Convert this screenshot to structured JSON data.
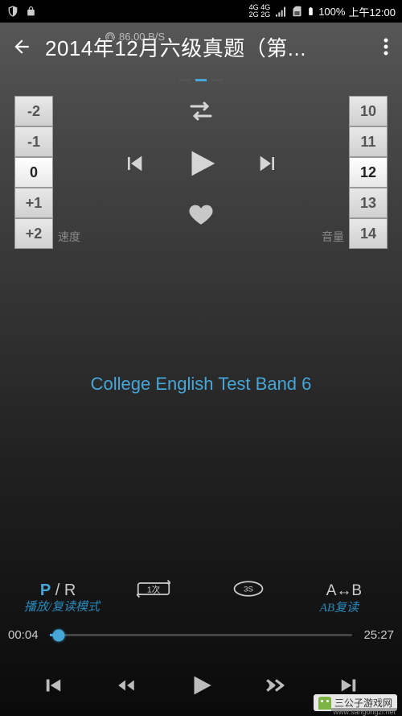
{
  "status_bar": {
    "net_4g": "4G",
    "net_2g": "2G",
    "sub_4g": "4G",
    "sub_2g": "2G",
    "battery": "100%",
    "time": "上午12:00"
  },
  "net_speed": "86.00 B/S",
  "header": {
    "title": "2014年12月六级真题（第..."
  },
  "speed_dial": {
    "items": [
      "-2",
      "-1",
      "0",
      "+1",
      "+2"
    ],
    "selected_index": 2,
    "label": "速度"
  },
  "volume_dial": {
    "items": [
      "10",
      "11",
      "12",
      "13",
      "14"
    ],
    "selected_index": 2,
    "label": "音量"
  },
  "transcript": "College English Test Band 6",
  "mode_row": {
    "pr_p": "P",
    "pr_slash": " / ",
    "pr_r": "R",
    "pr_annotation": "播放/复读模式",
    "repeat_count": "1次",
    "interval": "3S",
    "ab": "A↔B",
    "ab_annotation": "AB复读"
  },
  "progress": {
    "current": "00:04",
    "total": "25:27"
  },
  "watermark": {
    "text": "三公子游戏网",
    "url": "www.sangongzi.net"
  }
}
